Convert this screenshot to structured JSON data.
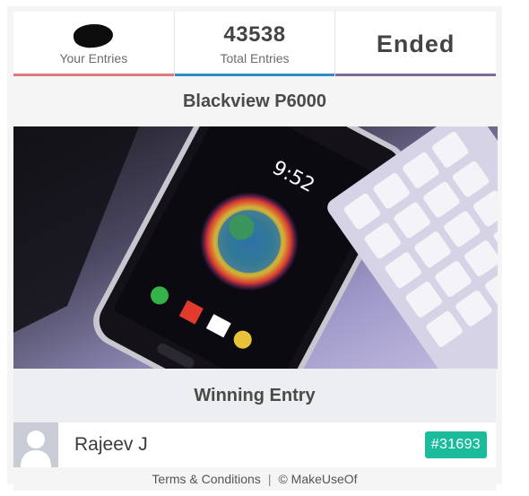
{
  "stats": {
    "your_entries_label": "Your Entries",
    "total_entries_value": "43538",
    "total_entries_label": "Total Entries",
    "status_value": "Ended"
  },
  "prize": {
    "title": "Blackview P6000",
    "image_name": "phone-on-desk-photo"
  },
  "winner": {
    "section_title": "Winning Entry",
    "name": "Rajeev J",
    "entry_number": "#31693"
  },
  "footer": {
    "terms_label": "Terms & Conditions",
    "separator": "|",
    "copyright": "© MakeUseOf"
  },
  "colors": {
    "your_entries_bar": "#e07a7a",
    "total_entries_bar": "#2e8ec4",
    "status_bar": "#7b6a9a",
    "badge": "#1abc9c"
  }
}
